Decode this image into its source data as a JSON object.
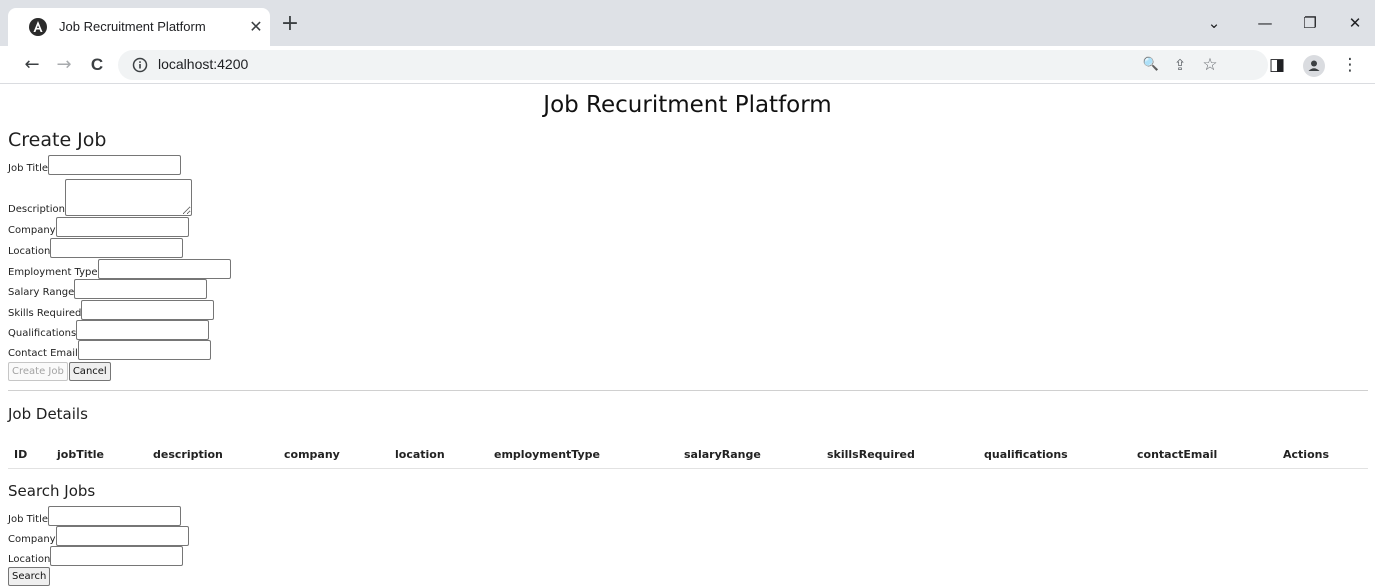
{
  "browser": {
    "tab_title": "Job Recruitment Platform",
    "tab_close": "✕",
    "new_tab": "+",
    "url": "localhost:4200",
    "window_controls": {
      "dropdown": "⌄",
      "minimize": "—",
      "restore": "❐",
      "close": "✕"
    },
    "nav": {
      "back": "←",
      "forward": "→",
      "reload": "C"
    },
    "toolbar_icons": {
      "zoom": "🔍",
      "share": "⇪",
      "bookmark": "☆",
      "sidepanel": "◨",
      "menu": "⋮"
    }
  },
  "page": {
    "title": "Job Recuritment Platform"
  },
  "create_job": {
    "heading": "Create Job",
    "fields": {
      "job_title": "Job Title",
      "description": "Description",
      "company": "Company",
      "location": "Location",
      "employment_type": "Employment Type",
      "salary_range": "Salary Range",
      "skills_required": "Skills Required",
      "qualifications": "Qualifications",
      "contact_email": "Contact Email"
    },
    "create_button": "Create Job",
    "cancel_button": "Cancel"
  },
  "job_details": {
    "heading": "Job Details",
    "columns": [
      "ID",
      "jobTitle",
      "description",
      "company",
      "location",
      "employmentType",
      "salaryRange",
      "skillsRequired",
      "qualifications",
      "contactEmail",
      "Actions"
    ]
  },
  "search_jobs": {
    "heading": "Search Jobs",
    "fields": {
      "job_title": "Job Title",
      "company": "Company",
      "location": "Location"
    },
    "search_button": "Search"
  }
}
